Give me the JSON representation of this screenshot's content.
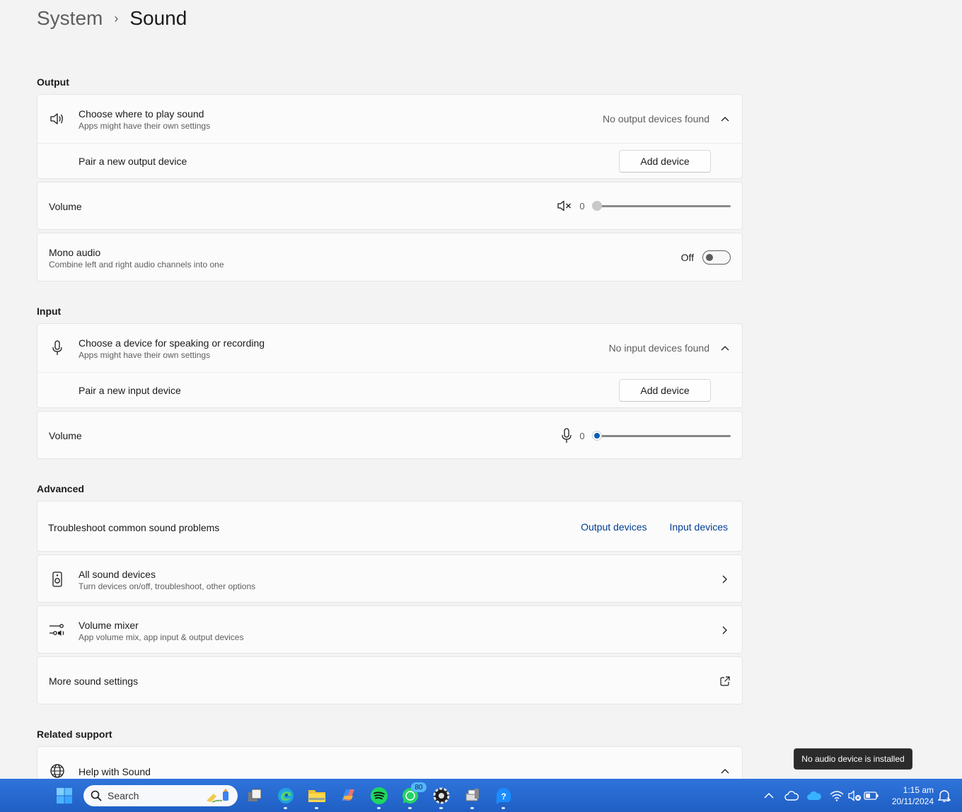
{
  "breadcrumb": {
    "parent": "System",
    "separator": "›",
    "current": "Sound"
  },
  "output": {
    "section_title": "Output",
    "choose": {
      "label": "Choose where to play sound",
      "sublabel": "Apps might have their own settings",
      "status": "No output devices found"
    },
    "pair": {
      "label": "Pair a new output device",
      "button": "Add device"
    },
    "volume": {
      "label": "Volume",
      "value": "0",
      "level": 0,
      "icon": "speaker-muted-icon"
    },
    "mono": {
      "label": "Mono audio",
      "sublabel": "Combine left and right audio channels into one",
      "state": "Off",
      "on": false
    }
  },
  "input": {
    "section_title": "Input",
    "choose": {
      "label": "Choose a device for speaking or recording",
      "sublabel": "Apps might have their own settings",
      "status": "No input devices found"
    },
    "pair": {
      "label": "Pair a new input device",
      "button": "Add device"
    },
    "volume": {
      "label": "Volume",
      "value": "0",
      "level": 0,
      "icon": "microphone-icon"
    }
  },
  "advanced": {
    "section_title": "Advanced",
    "troubleshoot": {
      "label": "Troubleshoot common sound problems",
      "link_output": "Output devices",
      "link_input": "Input devices"
    },
    "all_devices": {
      "label": "All sound devices",
      "sublabel": "Turn devices on/off, troubleshoot, other options"
    },
    "mixer": {
      "label": "Volume mixer",
      "sublabel": "App volume mix, app input & output devices"
    },
    "more": {
      "label": "More sound settings"
    }
  },
  "related": {
    "section_title": "Related support",
    "help": {
      "label": "Help with Sound"
    }
  },
  "tooltip": "No audio device is installed",
  "taskbar": {
    "search_placeholder": "Search",
    "whatsapp_badge": "80",
    "time": "1:15 am",
    "date": "20/11/2024"
  },
  "colors": {
    "accent": "#005fb8",
    "link": "#003e92",
    "taskbar": "#2a6fd6"
  }
}
